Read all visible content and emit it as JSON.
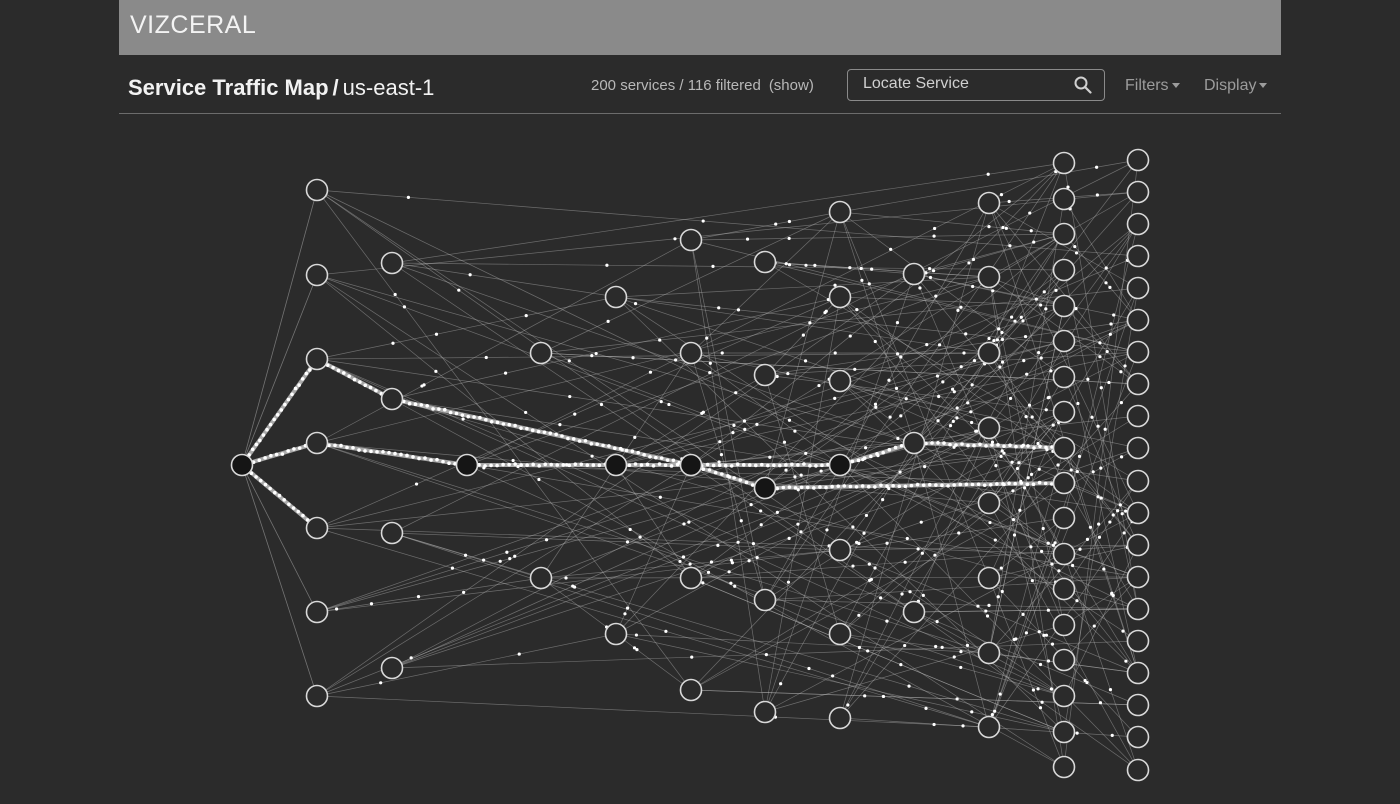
{
  "app": {
    "brand": "VIZCERAL"
  },
  "header": {
    "title_bold": "Service Traffic Map",
    "separator": "/",
    "region": "us-east-1",
    "count_text": "200 services / 116 filtered",
    "show_label": "(show)",
    "search_placeholder": "Locate Service",
    "filters_label": "Filters",
    "display_label": "Display"
  },
  "icons": {
    "search": "search-icon",
    "filters_caret": "caret-down-icon",
    "display_caret": "caret-down-icon"
  },
  "colors": {
    "background": "#2b2b2b",
    "brandbar": "#8a8a8a",
    "node_stroke": "#d9d9d9",
    "edge": "#bdbdbd",
    "particle": "#ffffff"
  }
}
